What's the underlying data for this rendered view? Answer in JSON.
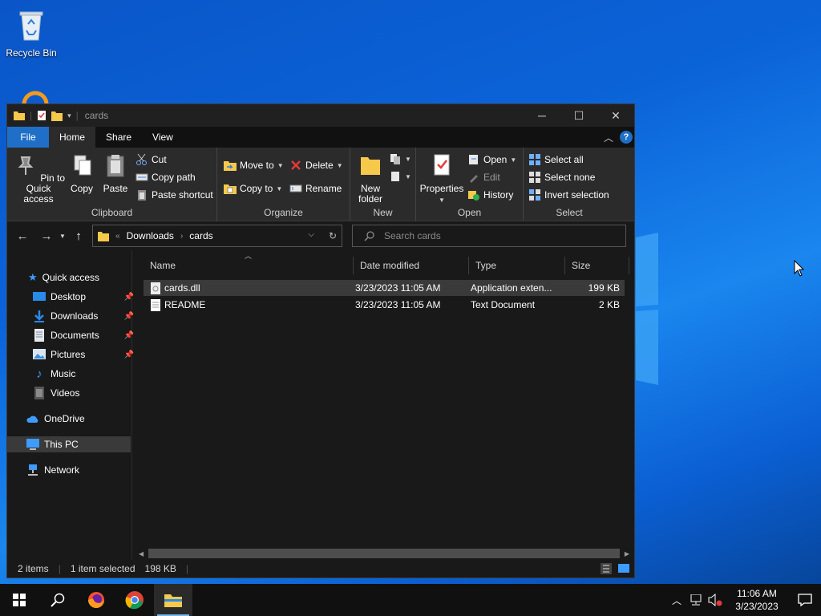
{
  "desktop": {
    "recycle_bin_label": "Recycle Bin"
  },
  "window": {
    "title": "cards",
    "tabs": [
      "File",
      "Home",
      "Share",
      "View"
    ],
    "active_tab": "Home"
  },
  "ribbon": {
    "clipboard": {
      "label": "Clipboard",
      "pin_label": "Pin to Quick access",
      "copy_label": "Copy",
      "paste_label": "Paste",
      "cut_label": "Cut",
      "copy_path_label": "Copy path",
      "paste_shortcut_label": "Paste shortcut"
    },
    "organize": {
      "label": "Organize",
      "move_to_label": "Move to",
      "copy_to_label": "Copy to",
      "delete_label": "Delete",
      "rename_label": "Rename"
    },
    "new": {
      "label": "New",
      "new_folder_label": "New folder"
    },
    "open": {
      "label": "Open",
      "properties_label": "Properties",
      "open_label": "Open",
      "edit_label": "Edit",
      "history_label": "History"
    },
    "select": {
      "label": "Select",
      "select_all_label": "Select all",
      "select_none_label": "Select none",
      "invert_label": "Invert selection"
    }
  },
  "address": {
    "crumbs": [
      "Downloads",
      "cards"
    ],
    "search_placeholder": "Search cards"
  },
  "nav": {
    "quick_access": "Quick access",
    "items": [
      {
        "label": "Desktop",
        "pinned": true
      },
      {
        "label": "Downloads",
        "pinned": true
      },
      {
        "label": "Documents",
        "pinned": true
      },
      {
        "label": "Pictures",
        "pinned": true
      },
      {
        "label": "Music",
        "pinned": false
      },
      {
        "label": "Videos",
        "pinned": false
      }
    ],
    "onedrive": "OneDrive",
    "this_pc": "This PC",
    "network": "Network"
  },
  "columns": [
    "Name",
    "Date modified",
    "Type",
    "Size"
  ],
  "files": [
    {
      "name": "cards.dll",
      "date": "3/23/2023 11:05 AM",
      "type": "Application exten...",
      "size": "199 KB",
      "selected": true
    },
    {
      "name": "README",
      "date": "3/23/2023 11:05 AM",
      "type": "Text Document",
      "size": "2 KB",
      "selected": false
    }
  ],
  "status": {
    "items": "2 items",
    "selection": "1 item selected",
    "size": "198 KB"
  },
  "taskbar": {
    "time": "11:06 AM",
    "date": "3/23/2023"
  },
  "colors": {
    "accent": "#1f6fc9",
    "window_bg": "#191919",
    "ribbon_bg": "#2b2b2b",
    "taskbar_bg": "#101010"
  }
}
